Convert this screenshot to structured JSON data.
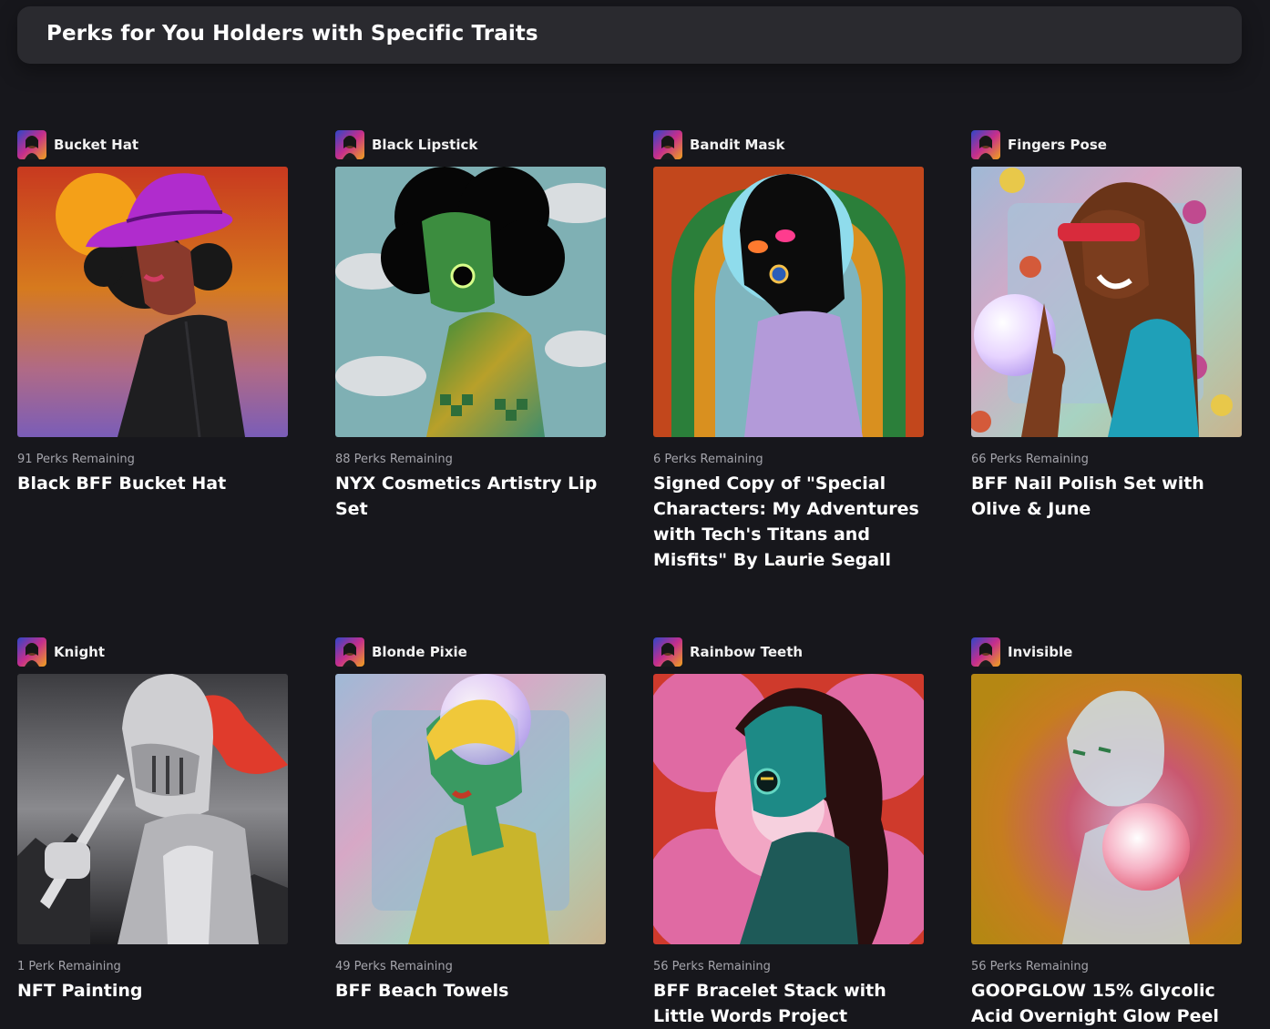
{
  "header": {
    "title": "Perks for You Holders with Specific Traits"
  },
  "cards": [
    {
      "trait": "Bucket Hat",
      "remaining": "91 Perks Remaining",
      "title": "Black BFF Bucket Hat"
    },
    {
      "trait": "Black Lipstick",
      "remaining": "88 Perks Remaining",
      "title": "NYX Cosmetics Artistry Lip Set"
    },
    {
      "trait": "Bandit Mask",
      "remaining": "6 Perks Remaining",
      "title": "Signed Copy of \"Special Characters: My Adventures with Tech's Titans and Misfits\" By Laurie Segall"
    },
    {
      "trait": "Fingers Pose",
      "remaining": "66 Perks Remaining",
      "title": "BFF Nail Polish Set with Olive & June"
    },
    {
      "trait": "Knight",
      "remaining": "1 Perk Remaining",
      "title": "NFT Painting"
    },
    {
      "trait": "Blonde Pixie",
      "remaining": "49 Perks Remaining",
      "title": "BFF Beach Towels"
    },
    {
      "trait": "Rainbow Teeth",
      "remaining": "56 Perks Remaining",
      "title": "BFF Bracelet Stack with Little Words Project"
    },
    {
      "trait": "Invisible",
      "remaining": "56 Perks Remaining",
      "title": "GOOPGLOW 15% Glycolic Acid Overnight Glow Peel"
    }
  ]
}
